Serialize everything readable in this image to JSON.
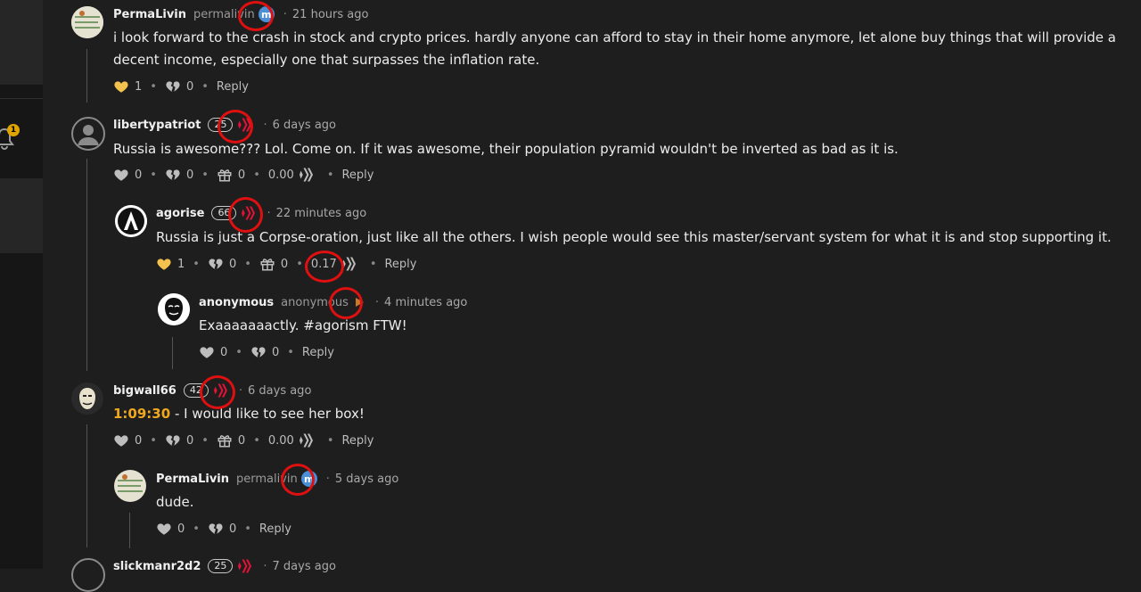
{
  "sidebar": {
    "notification_count": "1"
  },
  "comments": [
    {
      "username": "PermaLivin",
      "handle": "permalivin",
      "time": "21 hours ago",
      "text": "i look forward to the crash in stock and crypto prices. hardly anyone can afford to stay in their home anymore, let alone buy things that will provide a decent income, especially one that surpasses the inflation rate.",
      "likes": "1",
      "dislikes": "0",
      "reply": "Reply"
    },
    {
      "username": "libertypatriot",
      "rep": "25",
      "time": "6 days ago",
      "text": "Russia is awesome??? Lol. Come on. If it was awesome, their population pyramid wouldn't be inverted as bad as it is.",
      "likes": "0",
      "dislikes": "0",
      "gifts": "0",
      "payout": "0.00",
      "reply": "Reply"
    },
    {
      "username": "agorise",
      "rep": "66",
      "time": "22 minutes ago",
      "text": "Russia is just a Corpse-oration, just like all the others. I wish people would see this master/servant system for what it is and stop supporting it.",
      "likes": "1",
      "dislikes": "0",
      "gifts": "0",
      "payout": "0.17",
      "reply": "Reply"
    },
    {
      "username": "anonymous",
      "handle": "anonymous",
      "time": "4 minutes ago",
      "text": "Exaaaaaaactly. #agorism FTW!",
      "likes": "0",
      "dislikes": "0",
      "reply": "Reply"
    },
    {
      "username": "bigwall66",
      "rep": "42",
      "time": "6 days ago",
      "timestamp": "1:09:30",
      "text": " - I would like to see her box!",
      "likes": "0",
      "dislikes": "0",
      "gifts": "0",
      "payout": "0.00",
      "reply": "Reply"
    },
    {
      "username": "PermaLivin",
      "handle": "permalivin",
      "time": "5 days ago",
      "text": "dude.",
      "likes": "0",
      "dislikes": "0",
      "reply": "Reply"
    },
    {
      "username": "slickmanr2d2",
      "rep": "25",
      "time": "7 days ago"
    }
  ]
}
